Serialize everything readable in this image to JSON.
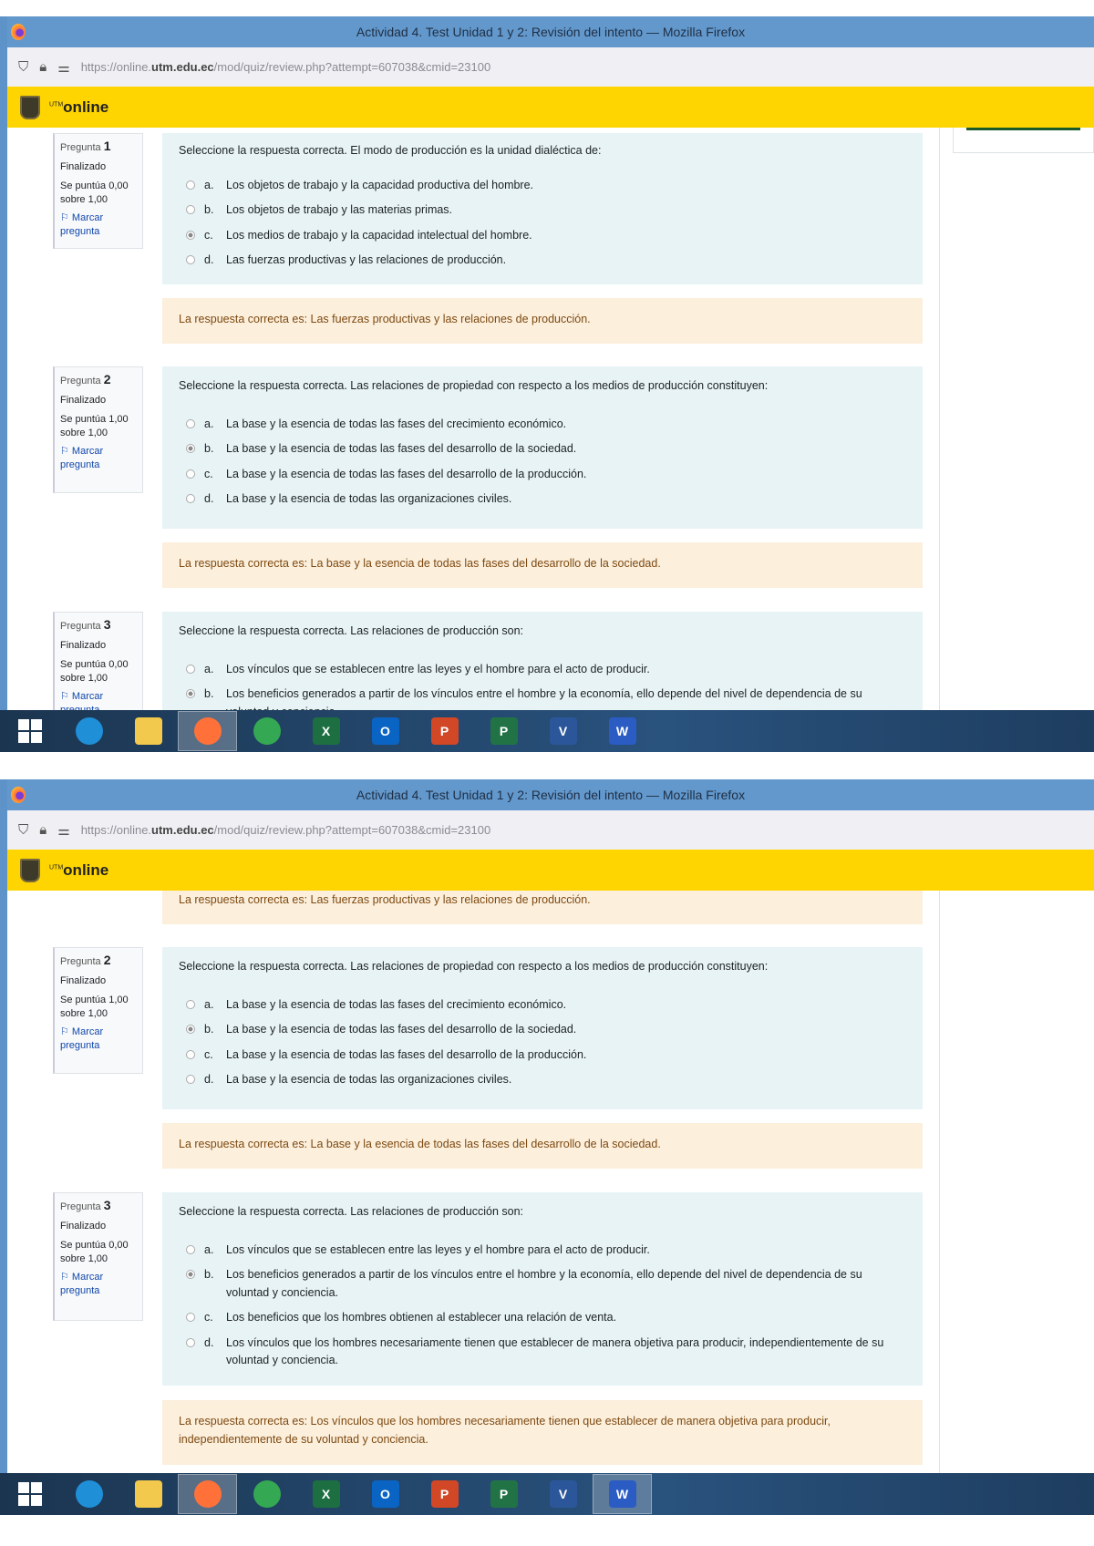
{
  "window": {
    "title": "Actividad 4. Test Unidad 1 y 2: Revisión del intento — Mozilla Firefox"
  },
  "urlbar": {
    "url_prefix": "https://online.",
    "url_domain": "utm.edu.ec",
    "url_path": "/mod/quiz/review.php?attempt=607038&cmid=23100"
  },
  "site": {
    "brand_sup": "UTM",
    "brand": "online"
  },
  "questions": [
    {
      "label": "Pregunta",
      "number": "1",
      "state": "Finalizado",
      "score": "Se puntúa 0,00 sobre 1,00",
      "flag": "Marcar pregunta",
      "text": "Seleccione la respuesta correcta. El modo de producción es la unidad dialéctica de:",
      "options": [
        {
          "letter": "a.",
          "text": "Los objetos de trabajo y la capacidad productiva del hombre.",
          "selected": false
        },
        {
          "letter": "b.",
          "text": "Los objetos de trabajo y las materias primas.",
          "selected": false
        },
        {
          "letter": "c.",
          "text": "Los medios de trabajo y la capacidad intelectual del hombre.",
          "selected": true
        },
        {
          "letter": "d.",
          "text": "Las fuerzas productivas y las relaciones de producción.",
          "selected": false
        }
      ],
      "feedback": "La respuesta correcta es: Las fuerzas productivas y las relaciones de producción."
    },
    {
      "label": "Pregunta",
      "number": "2",
      "state": "Finalizado",
      "score": "Se puntúa 1,00 sobre 1,00",
      "flag": "Marcar pregunta",
      "text": "Seleccione la respuesta correcta. Las relaciones de propiedad con respecto a los medios de producción constituyen:",
      "options": [
        {
          "letter": "a.",
          "text": "La base y la esencia de todas las fases del crecimiento económico.",
          "selected": false
        },
        {
          "letter": "b.",
          "text": "La base y la esencia de todas las fases del desarrollo de la sociedad.",
          "selected": true
        },
        {
          "letter": "c.",
          "text": "La base y la esencia de todas las fases del desarrollo de la producción.",
          "selected": false
        },
        {
          "letter": "d.",
          "text": "La base y la esencia de todas las organizaciones civiles.",
          "selected": false
        }
      ],
      "feedback": "La respuesta correcta es: La base y la esencia de todas las fases del desarrollo de la sociedad."
    },
    {
      "label": "Pregunta",
      "number": "3",
      "state": "Finalizado",
      "score": "Se puntúa 0,00 sobre 1,00",
      "flag": "Marcar pregunta",
      "text": "Seleccione la respuesta correcta. Las relaciones de producción son:",
      "options": [
        {
          "letter": "a.",
          "text": "Los vínculos que se establecen entre las leyes y el hombre para el acto de producir.",
          "selected": false
        },
        {
          "letter": "b.",
          "text": "Los beneficios generados a partir de los vínculos entre el hombre y la economía, ello depende del nivel de dependencia de su voluntad y conciencia.",
          "selected": true
        },
        {
          "letter": "c.",
          "text": "Los beneficios que los hombres obtienen al establecer una relación de venta.",
          "selected": false
        },
        {
          "letter": "d.",
          "text": "Los vínculos que los hombres necesariamente tienen que establecer de manera objetiva para producir, independientemente de su voluntad y conciencia.",
          "selected": false
        }
      ],
      "feedback": "La respuesta correcta es: Los vínculos que los hombres necesariamente tienen que establecer de manera objetiva para producir, independientemente de su voluntad y conciencia."
    }
  ],
  "taskbar": {
    "apps": [
      {
        "name": "edge-icon",
        "letter": "",
        "color": "#1f8fd8"
      },
      {
        "name": "file-explorer-icon",
        "letter": "",
        "color": "#f2c94c"
      },
      {
        "name": "firefox-icon",
        "letter": "",
        "color": "#ff7139"
      },
      {
        "name": "chrome-icon",
        "letter": "",
        "color": "#34a853"
      },
      {
        "name": "excel-icon",
        "letter": "X",
        "color": "#1d6f42"
      },
      {
        "name": "outlook-icon",
        "letter": "O",
        "color": "#0a64c4"
      },
      {
        "name": "powerpoint-icon",
        "letter": "P",
        "color": "#d24726"
      },
      {
        "name": "project-icon",
        "letter": "P",
        "color": "#217346"
      },
      {
        "name": "visio-icon",
        "letter": "V",
        "color": "#2b579a"
      },
      {
        "name": "word-icon",
        "letter": "W",
        "color": "#2b5cc4"
      }
    ]
  }
}
